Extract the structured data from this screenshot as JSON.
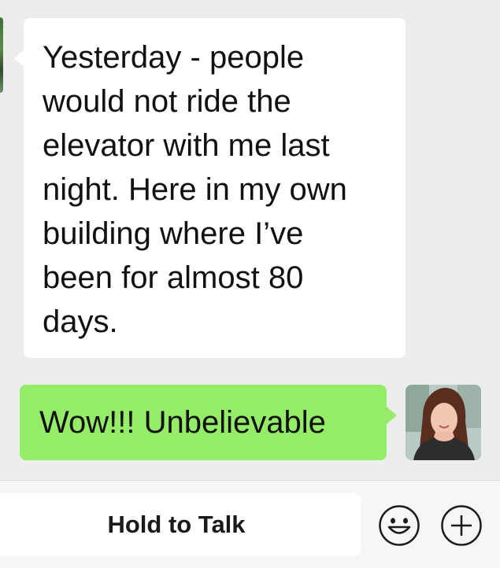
{
  "messages": [
    {
      "direction": "incoming",
      "text": "Yesterday - people\nwould not ride the\nelevator with me last\nnight. Here in my own\nbuilding where I’ve\nbeen for almost 80\ndays."
    },
    {
      "direction": "outgoing",
      "text": "Wow!!! Unbelievable"
    }
  ],
  "input_bar": {
    "hold_to_talk_label": "Hold to Talk",
    "emoji_icon": "smiley-face-icon",
    "plus_icon": "plus-circle-icon"
  },
  "colors": {
    "chat_background": "#ededed",
    "incoming_bubble": "#ffffff",
    "outgoing_bubble": "#95ec69",
    "input_bar_background": "#f6f6f6"
  }
}
